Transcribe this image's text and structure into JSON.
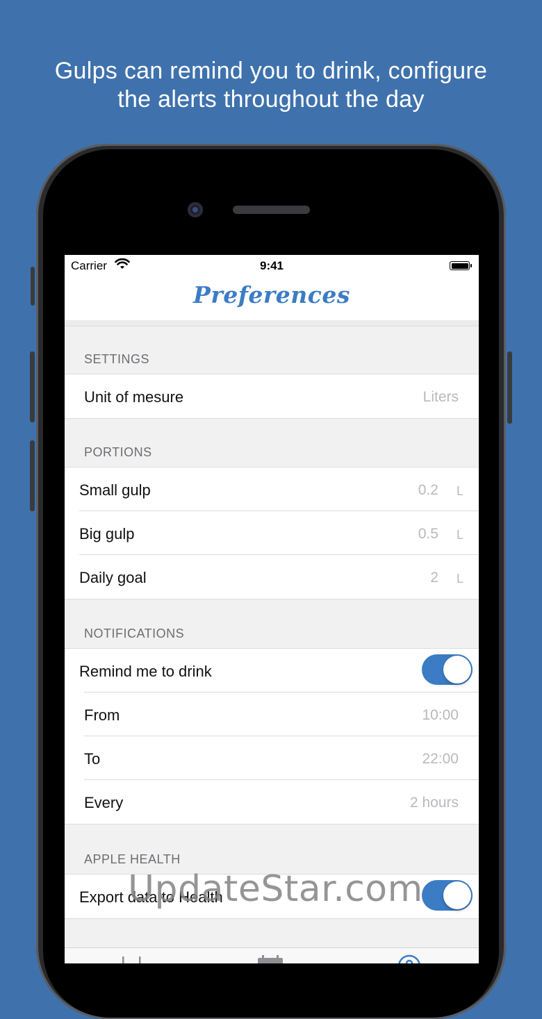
{
  "headline": {
    "line1": "Gulps can remind you to drink, configure",
    "line2": "the alerts throughout the day"
  },
  "status_bar": {
    "carrier": "Carrier",
    "time": "9:41"
  },
  "navbar": {
    "title": "Preferences"
  },
  "settings": {
    "header": "SETTINGS",
    "rows": [
      {
        "label": "Unit of mesure",
        "value": "Liters"
      }
    ]
  },
  "portions": {
    "header": "PORTIONS",
    "rows": [
      {
        "label": "Small gulp",
        "value": "0.2",
        "unit": "L"
      },
      {
        "label": "Big gulp",
        "value": "0.5",
        "unit": "L"
      },
      {
        "label": "Daily goal",
        "value": "2",
        "unit": "L"
      }
    ]
  },
  "notifications": {
    "header": "NOTIFICATIONS",
    "remind_label": "Remind me to drink",
    "remind_on": true,
    "rows": [
      {
        "label": "From",
        "value": "10:00"
      },
      {
        "label": "To",
        "value": "22:00"
      },
      {
        "label": "Every",
        "value": "2 hours"
      }
    ]
  },
  "apple_health": {
    "header": "APPLE HEALTH",
    "export_label": "Export data to Health",
    "export_on": true
  },
  "tabbar": {
    "icons": [
      "chart-icon",
      "calendar-icon",
      "settings-icon"
    ]
  },
  "watermark": "UpdateStar.com",
  "colors": {
    "background": "#3f72ad",
    "accent": "#3b7cc4",
    "value_text": "#b9b9be"
  }
}
